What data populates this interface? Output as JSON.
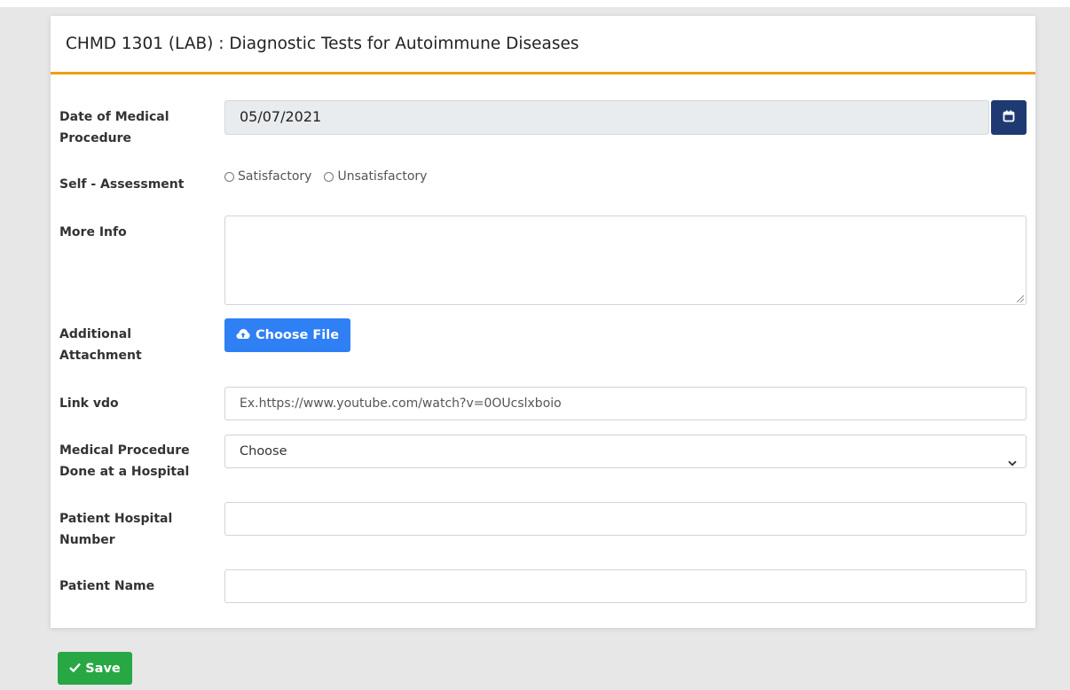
{
  "card": {
    "title": "CHMD 1301 (LAB) : Diagnostic Tests for Autoimmune Diseases"
  },
  "form": {
    "date": {
      "label": "Date of Medical Procedure",
      "value": "05/07/2021",
      "icon": "calendar-icon"
    },
    "self_assessment": {
      "label": "Self - Assessment",
      "options": [
        "Satisfactory",
        "Unsatisfactory"
      ]
    },
    "more_info": {
      "label": "More Info",
      "value": ""
    },
    "attachment": {
      "label": "Additional Attachment",
      "button_label": "Choose File",
      "icon": "cloud-upload-icon"
    },
    "link_vdo": {
      "label": "Link vdo",
      "placeholder": "Ex.https://www.youtube.com/watch?v=0OUcslxboio"
    },
    "hospital": {
      "label": "Medical Procedure Done at a Hospital",
      "selected": "Choose"
    },
    "hospital_number": {
      "label": "Patient Hospital Number",
      "value": ""
    },
    "patient_name": {
      "label": "Patient Name",
      "value": ""
    }
  },
  "actions": {
    "save_label": "Save",
    "save_icon": "check-icon"
  },
  "colors": {
    "accent_border": "#f39c12",
    "calendar_button": "#1f3a73",
    "choose_file_button": "#2f7ff5",
    "save_button": "#28a745",
    "page_background": "#e7e7e7"
  }
}
